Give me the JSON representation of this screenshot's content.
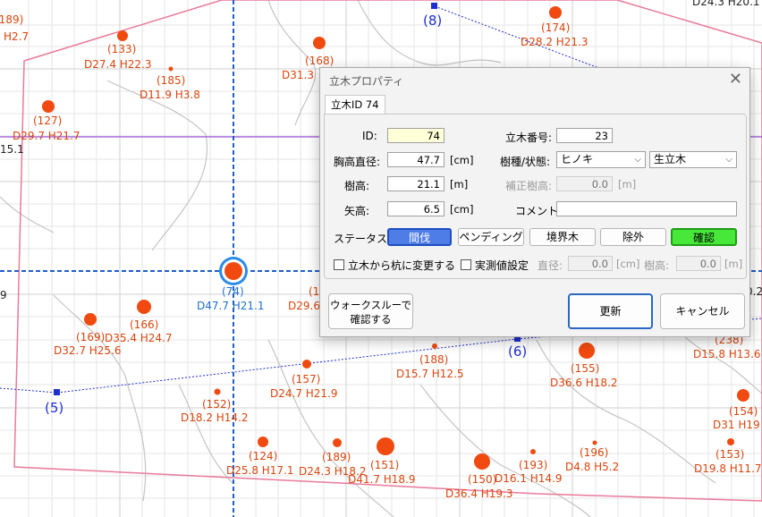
{
  "map": {
    "trees": [
      {
        "id": "189",
        "label": "(189)",
        "dh": "H2.7"
      },
      {
        "id": "133",
        "label": "(133)",
        "dh": "D27.4  H22.3"
      },
      {
        "id": "185",
        "label": "(185)",
        "dh": "D11.9  H3.8"
      },
      {
        "id": "127",
        "label": "(127)",
        "dh": "D29.7  H21.7"
      },
      {
        "id": "l15",
        "label": "",
        "dh": "15.1"
      },
      {
        "id": "168",
        "label": "(168)",
        "dh": "D31.3"
      },
      {
        "id": "174",
        "label": "(174)",
        "dh": "D28.2  H21.3"
      },
      {
        "id": "top",
        "label": "",
        "dh": "D24.3  H20.1"
      },
      {
        "id": "74",
        "label": "(74)",
        "dh": "D47.7  H21.1"
      },
      {
        "id": "l9",
        "label": "",
        "dh": "9"
      },
      {
        "id": "p1",
        "label": "(1",
        "dh": "D29.6"
      },
      {
        "id": "166",
        "label": "(166)",
        "dh": "D35.4  H24.7"
      },
      {
        "id": "169",
        "label": "(169)",
        "dh": "D32.7  H25.6"
      },
      {
        "id": "157",
        "label": "(157)",
        "dh": "D24.7  H21.9"
      },
      {
        "id": "188",
        "label": "(188)",
        "dh": "D15.7  H12.5"
      },
      {
        "id": "155",
        "label": "(155)",
        "dh": "D36.6  H18.2"
      },
      {
        "id": "238",
        "label": "(238)",
        "dh": "D15.8  H13.6"
      },
      {
        "id": "l02",
        "label": "",
        "dh": "0.2"
      },
      {
        "id": "152",
        "label": "(152)",
        "dh": "D18.2  H14.2"
      },
      {
        "id": "154",
        "label": "(154)",
        "dh": "D31  H19"
      },
      {
        "id": "124",
        "label": "(124)",
        "dh": "D25.8  H17.1"
      },
      {
        "id": "189b",
        "label": "(189)",
        "dh": "D24.3  H18.2"
      },
      {
        "id": "151",
        "label": "(151)",
        "dh": "D41.7  H18.9"
      },
      {
        "id": "150",
        "label": "(150)",
        "dh": "D36.4  H19.3"
      },
      {
        "id": "193",
        "label": "(193)",
        "dh": "D16.1  H14.9"
      },
      {
        "id": "196",
        "label": "(196)",
        "dh": "D4.8  H5.2"
      },
      {
        "id": "153",
        "label": "(153)",
        "dh": "D19.8  H11.7"
      }
    ],
    "stakes": [
      {
        "label": "(8)"
      },
      {
        "label": "(6)"
      },
      {
        "label": "(5)"
      }
    ],
    "colors": {
      "tree": "#f04a10",
      "stake": "#1d2fd0",
      "boundary": "#e97a9a",
      "crosshair": "#1e5fc8",
      "purpleline": "#8b2fd8"
    }
  },
  "dialog": {
    "title": "立木プロパティ",
    "close_icon": "close-icon",
    "tab_label": "立木ID 74",
    "fields": {
      "id_label": "ID:",
      "id_value": "74",
      "number_label": "立木番号:",
      "number_value": "23",
      "dbh_label": "胸高直径:",
      "dbh_value": "47.7",
      "dbh_unit": "[cm]",
      "species_label": "樹種/状態:",
      "species_value": "ヒノキ",
      "state_value": "生立木",
      "height_label": "樹高:",
      "height_value": "21.1",
      "height_unit": "[m]",
      "corr_height_label": "補正樹高:",
      "corr_height_value": "0.0",
      "corr_height_unit": "[m]",
      "arrow_label": "矢高:",
      "arrow_value": "6.5",
      "arrow_unit": "[cm]",
      "comment_label": "コメント:",
      "comment_value": ""
    },
    "status": {
      "label": "ステータス:",
      "buttons": [
        "間伐",
        "ペンディング",
        "境界木",
        "除外",
        "確認"
      ]
    },
    "options": {
      "stake_label": "立木から杭に変更する",
      "measured_label": "実測値設定",
      "m_dbh_label": "直径:",
      "m_dbh_value": "0.0",
      "m_dbh_unit": "[cm]",
      "m_height_label": "樹高:",
      "m_height_value": "0.0",
      "m_height_unit": "[m]"
    },
    "actions": {
      "walkthrough_line1": "ウォークスルーで",
      "walkthrough_line2": "確認する",
      "update": "更新",
      "cancel": "キャンセル"
    }
  }
}
